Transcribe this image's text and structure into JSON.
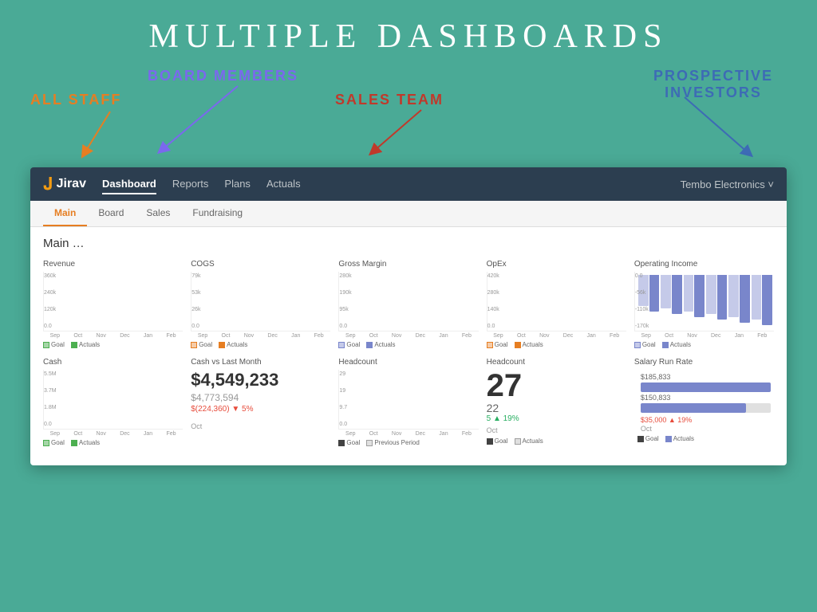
{
  "page": {
    "title": "MULTIPLE DASHBOARDS",
    "background": "#4aaa96"
  },
  "labels": {
    "all_staff": "ALL STAFF",
    "board_members": "BOARD MEMBERS",
    "sales_team": "SALES TEAM",
    "prospective_investors": "PROSPECTIVE\nINVESTORS"
  },
  "nav": {
    "logo": "Jirav",
    "links": [
      "Dashboard",
      "Reports",
      "Plans",
      "Actuals"
    ],
    "active_link": "Dashboard",
    "company": "Tembo Electronics ˅"
  },
  "sub_tabs": {
    "tabs": [
      "Main",
      "Board",
      "Sales",
      "Fundraising"
    ],
    "active": "Main"
  },
  "section": {
    "title": "Main …"
  },
  "row1": {
    "charts": [
      {
        "title": "Revenue",
        "y_labels": [
          "360k",
          "240k",
          "120k",
          "0.0"
        ],
        "x_labels": [
          "Sep",
          "Oct",
          "Nov",
          "Dec",
          "Jan",
          "Feb"
        ],
        "legend": [
          "Goal",
          "Actuals"
        ],
        "type": "bar_pair",
        "colors": [
          "green_light",
          "green"
        ]
      },
      {
        "title": "COGS",
        "y_labels": [
          "79k",
          "53k",
          "26k",
          "0.0"
        ],
        "x_labels": [
          "Sep",
          "Oct",
          "Nov",
          "Dec",
          "Jan",
          "Feb"
        ],
        "legend": [
          "Goal",
          "Actuals"
        ],
        "type": "bar_pair",
        "colors": [
          "orange_light",
          "orange"
        ]
      },
      {
        "title": "Gross Margin",
        "y_labels": [
          "280k",
          "190k",
          "95k",
          "0.0"
        ],
        "x_labels": [
          "Sep",
          "Oct",
          "Nov",
          "Dec",
          "Jan",
          "Feb"
        ],
        "legend": [
          "Goal",
          "Actuals"
        ],
        "type": "bar_pair",
        "colors": [
          "blue_light",
          "blue"
        ]
      },
      {
        "title": "OpEx",
        "y_labels": [
          "420k",
          "280k",
          "140k",
          "0.0"
        ],
        "x_labels": [
          "Sep",
          "Oct",
          "Nov",
          "Dec",
          "Jan",
          "Feb"
        ],
        "legend": [
          "Goal",
          "Actuals"
        ],
        "type": "bar_pair",
        "colors": [
          "orange_light",
          "orange"
        ]
      },
      {
        "title": "Operating Income",
        "y_labels": [
          "0.0",
          "-56k",
          "-110k",
          "-170k"
        ],
        "x_labels": [
          "Sep",
          "Oct",
          "Nov",
          "Dec",
          "Jan",
          "Feb"
        ],
        "legend": [
          "Goal",
          "Actuals"
        ],
        "type": "negative",
        "colors": [
          "blue_light",
          "blue"
        ]
      }
    ]
  },
  "row2": {
    "charts": [
      {
        "title": "Cash",
        "y_labels": [
          "5.5M",
          "3.7M",
          "1.8M",
          "0.0"
        ],
        "x_labels": [
          "Sep",
          "Oct",
          "Nov",
          "Dec",
          "Jan",
          "Feb"
        ],
        "legend": [
          "Goal",
          "Actuals"
        ],
        "type": "bar_pair",
        "colors": [
          "green_light",
          "green"
        ]
      },
      {
        "title": "Cash vs Last Month",
        "type": "big_number",
        "main": "$4,549,233",
        "sub": "$4,773,594",
        "change": "$(224,360) ▼ 5%"
      },
      {
        "title": "Headcount",
        "y_labels": [
          "29",
          "19",
          "9.7",
          "0.0"
        ],
        "x_labels": [
          "Sep",
          "Oct",
          "Nov",
          "Dec",
          "Jan",
          "Feb"
        ],
        "legend": [
          "Goal",
          "Previous Period"
        ],
        "type": "bar_pair",
        "colors": [
          "dark_light",
          "dark"
        ]
      },
      {
        "title": "Headcount",
        "type": "headcount_big",
        "main": "27",
        "sub": "22",
        "change": "5 ▲ 19%",
        "x_label": "Oct",
        "legend": [
          "Goal",
          "Actuals"
        ]
      },
      {
        "title": "Salary Run Rate",
        "type": "salary",
        "bar1_label": "$185,833",
        "bar1_pct": 100,
        "bar2_label": "$150,833",
        "bar2_pct": 81,
        "change": "$35,000 ▲ 19%",
        "change_label": "Oct",
        "legend": [
          "Goal",
          "Actuals"
        ]
      }
    ]
  }
}
